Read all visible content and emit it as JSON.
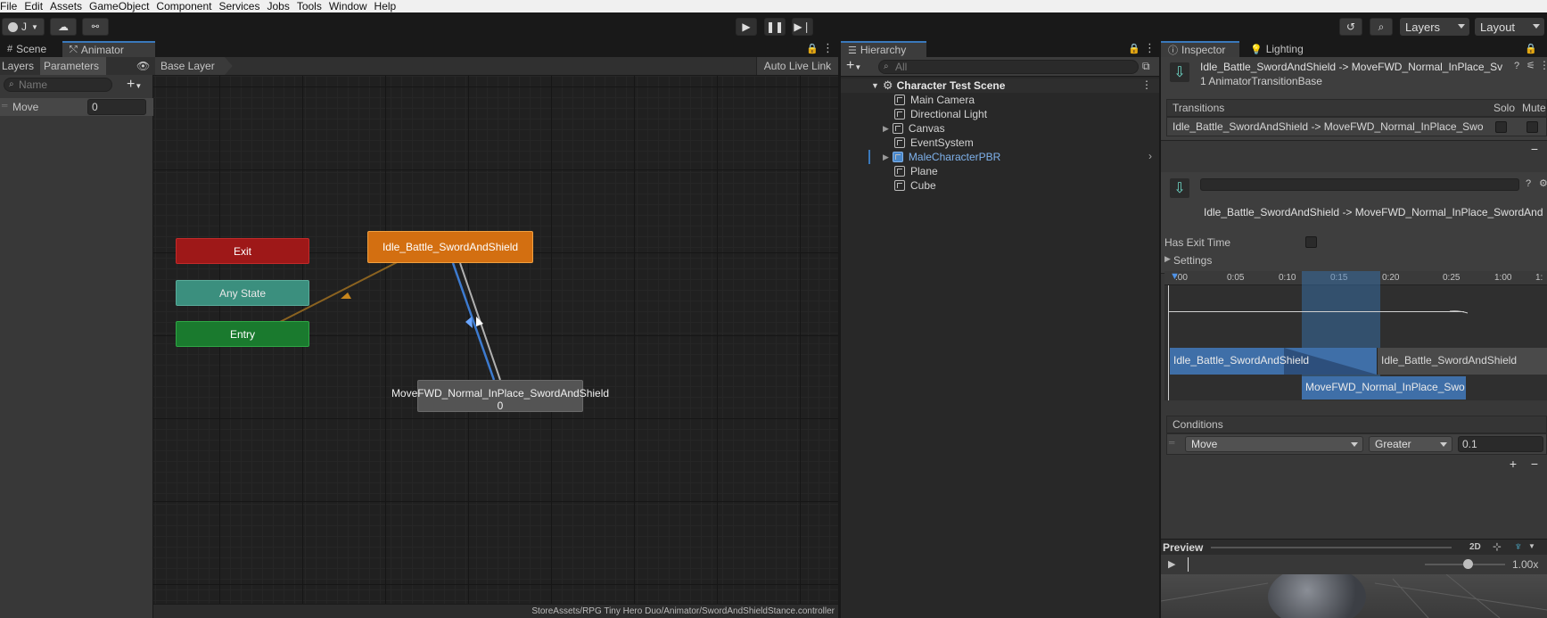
{
  "menu": [
    "File",
    "Edit",
    "Assets",
    "GameObject",
    "Component",
    "Services",
    "Jobs",
    "Tools",
    "Window",
    "Help"
  ],
  "toolbar": {
    "account_label": "J",
    "layers_label": "Layers",
    "layout_label": "Layout"
  },
  "animator": {
    "tabs": {
      "scene": "Scene",
      "animator": "Animator"
    },
    "subtabs": {
      "layers": "Layers",
      "parameters": "Parameters"
    },
    "search_placeholder": "Name",
    "parameter": {
      "name": "Move",
      "value": "0"
    },
    "breadcrumb": "Base Layer",
    "auto_live_link": "Auto Live Link",
    "nodes": {
      "exit": "Exit",
      "any_state": "Any State",
      "entry": "Entry",
      "idle": "Idle_Battle_SwordAndShield",
      "move": "MoveFWD_Normal_InPlace_SwordAndShield 0"
    },
    "status_path": "StoreAssets/RPG Tiny Hero Duo/Animator/SwordAndShieldStance.controller"
  },
  "hierarchy": {
    "title": "Hierarchy",
    "search_placeholder": "All",
    "scene": "Character Test Scene",
    "items": [
      {
        "label": "Main Camera",
        "expandable": false
      },
      {
        "label": "Directional Light",
        "expandable": false
      },
      {
        "label": "Canvas",
        "expandable": true
      },
      {
        "label": "EventSystem",
        "expandable": false
      },
      {
        "label": "MaleCharacterPBR",
        "expandable": true,
        "prefab": true
      },
      {
        "label": "Plane",
        "expandable": false
      },
      {
        "label": "Cube",
        "expandable": false
      }
    ],
    "prefab_color": "#7fb2ec"
  },
  "inspector": {
    "tabs": {
      "inspector": "Inspector",
      "lighting": "Lighting"
    },
    "header_title": "Idle_Battle_SwordAndShield -> MoveFWD_Normal_InPlace_Sv",
    "header_subtitle": "1 AnimatorTransitionBase",
    "transitions_label": "Transitions",
    "solo_label": "Solo",
    "mute_label": "Mute",
    "transition_item": "Idle_Battle_SwordAndShield -> MoveFWD_Normal_InPlace_Swo",
    "transition_full": "Idle_Battle_SwordAndShield -> MoveFWD_Normal_InPlace_SwordAnd",
    "has_exit_time": "Has Exit Time",
    "settings": "Settings",
    "timeline_ticks": [
      ":00",
      "0:05",
      "0:10",
      "0:15",
      "0:20",
      "0:25",
      "1:00",
      "1:"
    ],
    "clip_from": "Idle_Battle_SwordAndShield",
    "clip_from_next": "Idle_Battle_SwordAndShield",
    "clip_to": "MoveFWD_Normal_InPlace_Swo",
    "conditions_label": "Conditions",
    "condition": {
      "parameter": "Move",
      "mode": "Greater",
      "threshold": "0.1"
    },
    "preview_label": "Preview",
    "preview_2d": "2D",
    "preview_speed": "1.00x",
    "accent_color": "#3a79bb"
  }
}
